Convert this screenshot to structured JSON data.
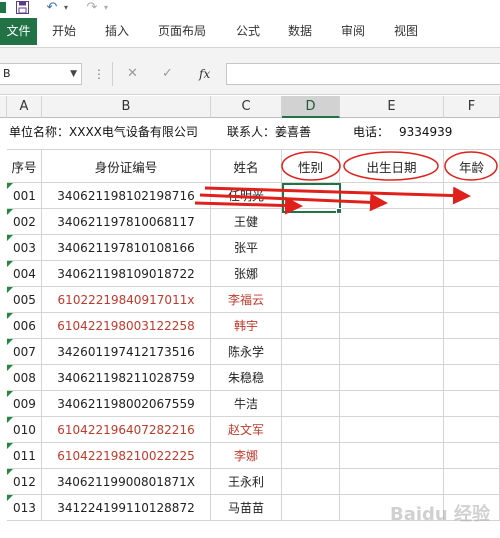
{
  "quick_access": {
    "undo_symbol": "↶",
    "redo_symbol": "↷"
  },
  "ribbon": {
    "file": "文件",
    "tabs": [
      "开始",
      "插入",
      "页面布局",
      "公式",
      "数据",
      "审阅",
      "视图"
    ]
  },
  "formula_bar": {
    "name_box": "B",
    "fx": "fx",
    "cancel": "✕",
    "enter": "✓",
    "content": ""
  },
  "columns": [
    "A",
    "B",
    "C",
    "D",
    "E",
    "F"
  ],
  "info_row": {
    "unit": "单位名称：XXXX电气设备有限公司",
    "contact": "联系人：姜喜善",
    "phone_label": "电话：",
    "phone": "9334939"
  },
  "table_headers": {
    "seq": "序号",
    "id": "身份证编号",
    "name": "姓名",
    "gender": "性别",
    "birth": "出生日期",
    "age": "年龄"
  },
  "rows": [
    {
      "seq": "001",
      "id": "340621198102198716",
      "name": "任明光",
      "red": false
    },
    {
      "seq": "002",
      "id": "340621197810068117",
      "name": "王健",
      "red": false
    },
    {
      "seq": "003",
      "id": "340621197810108166",
      "name": "张平",
      "red": false
    },
    {
      "seq": "004",
      "id": "340621198109018722",
      "name": "张娜",
      "red": false
    },
    {
      "seq": "005",
      "id": "61022219840917011x",
      "name": "李福云",
      "red": true
    },
    {
      "seq": "006",
      "id": "610422198003122258",
      "name": "韩宇",
      "red": true
    },
    {
      "seq": "007",
      "id": "342601197412173516",
      "name": "陈永学",
      "red": false
    },
    {
      "seq": "008",
      "id": "340621198211028759",
      "name": "朱稳稳",
      "red": false
    },
    {
      "seq": "009",
      "id": "340621198002067559",
      "name": "牛洁",
      "red": false
    },
    {
      "seq": "010",
      "id": "610422196407282216",
      "name": "赵文军",
      "red": true
    },
    {
      "seq": "011",
      "id": "610422198210022225",
      "name": "李娜",
      "red": true
    },
    {
      "seq": "012",
      "id": "34062119900801871X",
      "name": "王永利",
      "red": false
    },
    {
      "seq": "013",
      "id": "341224199110128872",
      "name": "马苗苗",
      "red": false
    }
  ],
  "colors": {
    "accent": "#217346",
    "annotation_red": "#e0201b",
    "data_red": "#c0392b"
  },
  "watermark": "Baidu 经验"
}
